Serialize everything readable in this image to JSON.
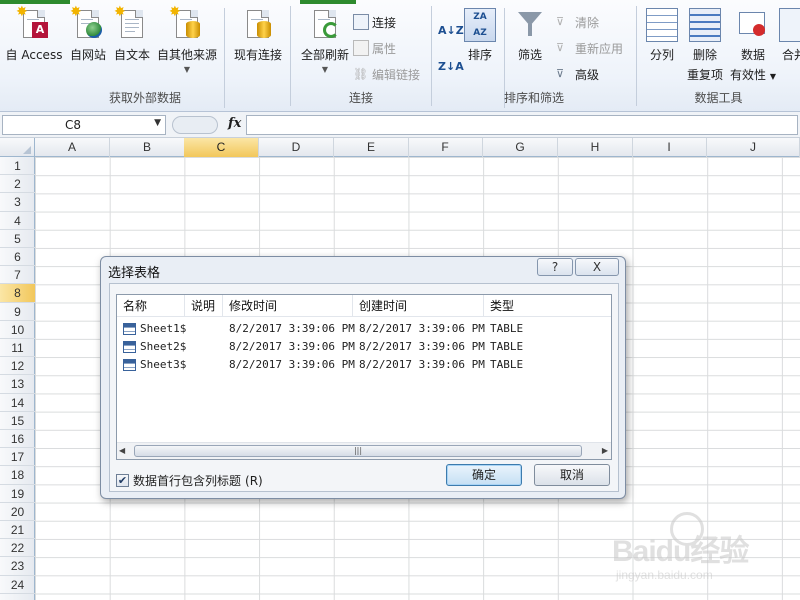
{
  "ribbon": {
    "groups": [
      {
        "label": "获取外部数据"
      },
      {
        "label": "连接"
      },
      {
        "label": "排序和筛选"
      },
      {
        "label": "数据工具"
      }
    ],
    "buttons": {
      "from_access": "自 Access",
      "from_web": "自网站",
      "from_text": "自文本",
      "from_other": "自其他来源",
      "existing_connections": "现有连接",
      "refresh_all": "全部刷新",
      "connections": "连接",
      "properties": "属性",
      "edit_links": "编辑链接",
      "sort": "排序",
      "filter": "筛选",
      "clear": "清除",
      "reapply": "重新应用",
      "advanced": "高级",
      "text_to_columns": "分列",
      "remove_dup_1": "删除",
      "remove_dup_2": "重复项",
      "validation_1": "数据",
      "validation_2": "有效性",
      "consolidate": "合并"
    }
  },
  "formula_bar": {
    "name_box": "C8",
    "fx": "fx",
    "formula": ""
  },
  "grid": {
    "columns": [
      "A",
      "B",
      "C",
      "D",
      "E",
      "F",
      "G",
      "H",
      "I",
      "J"
    ],
    "selected_column": "C",
    "rows": [
      "1",
      "2",
      "3",
      "4",
      "5",
      "6",
      "7",
      "8",
      "9",
      "10",
      "11",
      "12",
      "13",
      "14",
      "15",
      "16",
      "17",
      "18",
      "19",
      "20",
      "21",
      "22",
      "23",
      "24"
    ],
    "selected_row": "8"
  },
  "dialog": {
    "title": "选择表格",
    "help": "?",
    "close": "X",
    "columns": [
      "名称",
      "说明",
      "修改时间",
      "创建时间",
      "类型"
    ],
    "rows": [
      {
        "name": "Sheet1$",
        "description": "",
        "modified": "8/2/2017 3:39:06 PM",
        "created": "8/2/2017 3:39:06 PM",
        "type": "TABLE"
      },
      {
        "name": "Sheet2$",
        "description": "",
        "modified": "8/2/2017 3:39:06 PM",
        "created": "8/2/2017 3:39:06 PM",
        "type": "TABLE"
      },
      {
        "name": "Sheet3$",
        "description": "",
        "modified": "8/2/2017 3:39:06 PM",
        "created": "8/2/2017 3:39:06 PM",
        "type": "TABLE"
      }
    ],
    "scroll_thumb": "|||",
    "checkbox_label": "数据首行包含列标题",
    "checkbox_shortcut": "(R)",
    "checkbox_checked": true,
    "ok": "确定",
    "cancel": "取消"
  },
  "watermark": {
    "brand": "Baidu经验",
    "url": "jingyan.baidu.com"
  }
}
